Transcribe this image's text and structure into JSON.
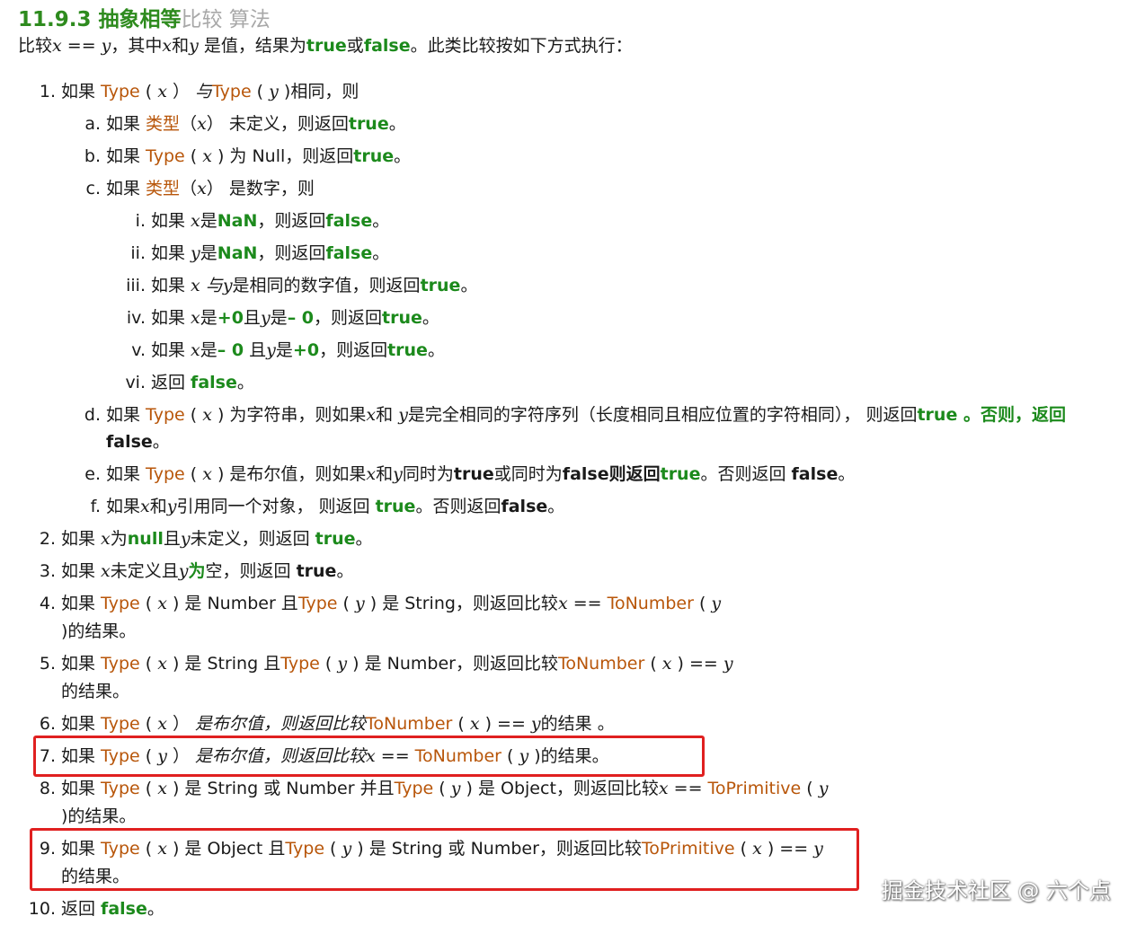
{
  "heading": {
    "green": "11.9.3 抽象相等",
    "grey": "比较 算法"
  },
  "intro": {
    "t1": "比较",
    "x": "x",
    "eq": " == ",
    "y": "y",
    "t2": "，其中",
    "x2": "x",
    "t3": "和",
    "y2": "y",
    "t4": " 是值，结果为",
    "true": "true",
    "or": "或",
    "false": "false",
    "t5": "。此类比较按如下方式执行："
  },
  "items": {
    "i1": {
      "num": "1.",
      "a": "如果 ",
      "type1": "Type",
      "p1": " ( ",
      "x": "x",
      "p2": " ）",
      "yu": " 与",
      "type2": "Type",
      "p3": " ( ",
      "y": "y",
      "p4": " )相同，则"
    },
    "a": {
      "num": "a.",
      "a": "如果 ",
      "type": "类型",
      "p1": "（",
      "x": "x",
      "p2": "）",
      "b": " 未定义，则返回",
      "val": "true",
      "end": "。"
    },
    "b": {
      "num": "b.",
      "a": "如果 ",
      "type": "Type",
      "p1": " ( ",
      "x": "x",
      "p2": " ) ",
      "b": "为 Null，则返回",
      "val": "true",
      "end": "。"
    },
    "c": {
      "num": "c.",
      "a": "如果 ",
      "type": "类型",
      "p1": "（",
      "x": "x",
      "p2": "）",
      "b": " 是数字，则"
    },
    "ci": {
      "num": "i.",
      "a": "如果 ",
      "x": "x",
      "b": "是",
      "nan": "NaN",
      "c": "，则返回",
      "val": "false",
      "end": "。"
    },
    "cii": {
      "num": "ii.",
      "a": "如果 ",
      "y": "y",
      "b": "是",
      "nan": "NaN",
      "c": "，则返回",
      "val": "false",
      "end": "。"
    },
    "ciii": {
      "num": "iii.",
      "a": "如果 ",
      "x": "x",
      "yu": " 与",
      "y": "y",
      "b": "是相同的数字值，则返回",
      "val": "true",
      "end": "。"
    },
    "civ": {
      "num": "iv.",
      "a": "如果 ",
      "x": "x",
      "b": "是",
      "v1": "+0",
      "c": "且",
      "y": "y",
      "d": "是",
      "v2": "– 0",
      "e": "，则返回",
      "val": "true",
      "end": "。"
    },
    "cv": {
      "num": "v.",
      "a": "如果 ",
      "x": "x",
      "b": "是",
      "v1": "– 0",
      "c": " 且",
      "y": "y",
      "d": "是",
      "v2": "+0",
      "e": "，则返回",
      "val": "true",
      "end": "。"
    },
    "cvi": {
      "num": "vi.",
      "a": "返回 ",
      "val": "false",
      "end": "。"
    },
    "d": {
      "num": "d.",
      "a": "如果 ",
      "type": "Type",
      "p1": " ( ",
      "x": "x",
      "p2": " ) ",
      "b": "为字符串，则如果",
      "x2": "x",
      "c": "和 ",
      "y": "y",
      "e": "是完全相同的字符序列（长度相同且相应位置的字符相同）， 则返回",
      "val": "true",
      "f": " 。否则，返回",
      "cont": "false",
      "end": "。"
    },
    "e": {
      "num": "e.",
      "a": "如果 ",
      "type": "Type",
      "p1": " ( ",
      "x": "x",
      "p2": " ) ",
      "b": "是布尔值，则如果",
      "x2": "x",
      "c": "和",
      "y": "y",
      "d": "同时为",
      "v1": "true",
      "e": "或同时为",
      "v2": "false",
      "f": "则返回",
      "val": "true",
      "g": "。否则返回 ",
      "v3": "false",
      "end": "。"
    },
    "f": {
      "num": "f.",
      "a": "如果",
      "x": "x",
      "b": "和",
      "y": "y",
      "c": "引用同一个对象， 则返回 ",
      "val": "true",
      "d": "。否则返回",
      "v2": "false",
      "end": "。"
    },
    "i2": {
      "num": "2.",
      "a": "如果 ",
      "x": "x",
      "b": "为",
      "null": "null",
      "c": "且",
      "y": "y",
      "d": "未定义，则返回 ",
      "val": "true",
      "end": "。"
    },
    "i3": {
      "num": "3.",
      "a": "如果 ",
      "x": "x",
      "b": "未定义且",
      "y": "y",
      "c": "为",
      "d": "空，则返回 ",
      "val": "true",
      "end": "。"
    },
    "i4": {
      "num": "4.",
      "a": "如果 ",
      "type1": "Type",
      "p1": " ( ",
      "x": "x",
      "p2": " ) ",
      "b": "是 Number 且",
      "type2": "Type",
      "p3": " ( ",
      "y": "y",
      "p4": " ) ",
      "c": "是 String，则返回比较",
      "x2": "x",
      "eq": " == ",
      "tonum": "ToNumber",
      "p5": " ( ",
      "y2": "y",
      "cont": ")的结果。"
    },
    "i5": {
      "num": "5.",
      "a": "如果 ",
      "type1": "Type",
      "p1": " ( ",
      "x": "x",
      "p2": " ) ",
      "b": "是 String 且",
      "type2": "Type",
      "p3": " ( ",
      "y": "y",
      "p4": " ) ",
      "c": "是 Number，则返回比较",
      "tonum": "ToNumber",
      "p5": " ( ",
      "x2": "x",
      "p6": " ) == ",
      "y2": "y",
      "cont": "的结果。"
    },
    "i6": {
      "num": "6.",
      "a": "如果 ",
      "type": "Type",
      "p1": " ( ",
      "x": "x",
      "p2": " ）",
      "b": " 是布尔值，则返回比较",
      "tonum": "ToNumber",
      "p3": " ( ",
      "x2": "x",
      "p4": " ) == ",
      "y": "y",
      "c": "的结果 。"
    },
    "i7": {
      "num": "7.",
      "a": "如果 ",
      "type": "Type",
      "p1": " ( ",
      "y": "y",
      "p2": " ）",
      "b": " 是布尔值，则返回比较",
      "x": "x",
      "eq": " == ",
      "tonum": "ToNumber",
      "p3": " ( ",
      "y2": "y",
      "c": " )的结果。"
    },
    "i8": {
      "num": "8.",
      "a": "如果 ",
      "type1": "Type",
      "p1": " ( ",
      "x": "x",
      "p2": " ) ",
      "b": "是 String 或 Number 并且",
      "type2": "Type",
      "p3": " ( ",
      "y": "y",
      "p4": " ) ",
      "c": "是 Object，则返回比较",
      "x2": "x",
      "eq": " == ",
      "toprim": "ToPrimitive",
      "p5": " ( ",
      "y2": "y",
      "cont": ")的结果。"
    },
    "i9": {
      "num": "9.",
      "a": "如果 ",
      "type1": "Type",
      "p1": " ( ",
      "x": "x",
      "p2": " ) ",
      "b": "是 Object 且",
      "type2": "Type",
      "p3": " ( ",
      "y": "y",
      "p4": " ) ",
      "c": "是 String 或 Number，则返回比较",
      "toprim": "ToPrimitive",
      "p5": " ( ",
      "x2": "x",
      "p6": " ) == ",
      "y2": "y",
      "cont": "的结果。"
    },
    "i10": {
      "num": "10.",
      "a": "返回 ",
      "val": "false",
      "end": "。"
    }
  },
  "watermark": "掘金技术社区 @ 六个点",
  "colors": {
    "heading": "#2e8b1e",
    "keyword": "#1c8a1c",
    "type": "#b8560a",
    "highlight_box": "#e02020"
  }
}
